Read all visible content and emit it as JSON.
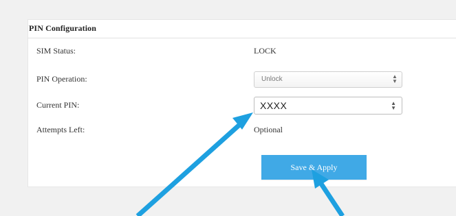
{
  "section": {
    "title": "PIN Configuration"
  },
  "rows": {
    "sim_status": {
      "label": "SIM Status:",
      "value": "LOCK"
    },
    "pin_operation": {
      "label": "PIN Operation:",
      "selected": "Unlock"
    },
    "current_pin": {
      "label": "Current PIN:",
      "value": "XXXX"
    },
    "attempts_left": {
      "label": "Attempts Left:",
      "value": "Optional"
    }
  },
  "actions": {
    "save_apply_label": "Save & Apply"
  },
  "colors": {
    "button_bg": "#40a9e6",
    "arrow": "#1ea0e0"
  },
  "icons": {
    "select_arrow": "chevron-updown-icon",
    "annotation_arrow": "arrow-icon"
  }
}
